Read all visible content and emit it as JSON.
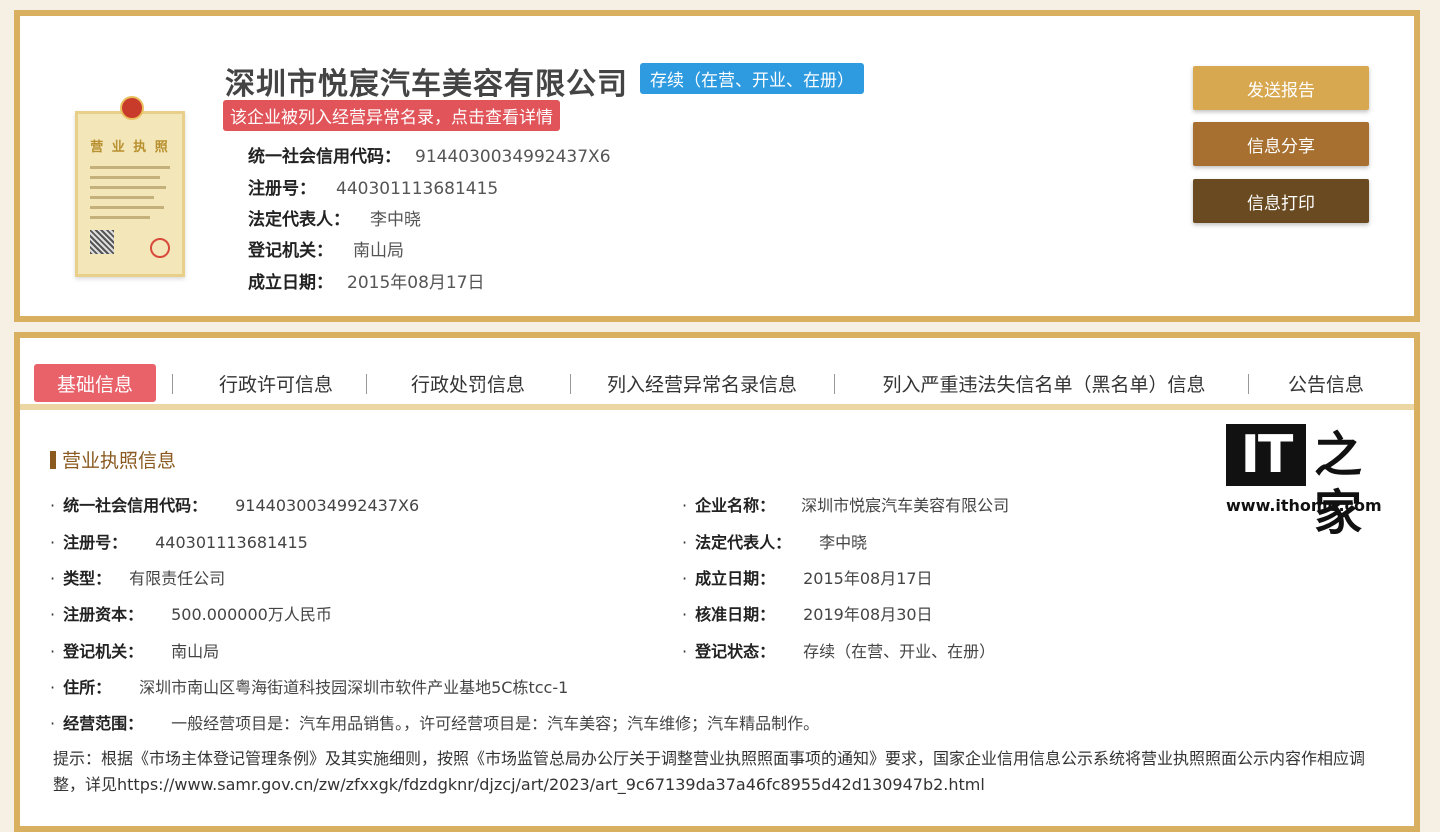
{
  "header": {
    "company_name": "深圳市悦宸汽车美容有限公司",
    "status": "存续（在营、开业、在册）",
    "abnormal_alert": "该企业被列入经营异常名录，点击查看详情",
    "license_title": "营 业 执 照",
    "summary": [
      {
        "key": "统一社会信用代码：",
        "value": "9144030034992437X6"
      },
      {
        "key": "注册号：",
        "value": "440301113681415"
      },
      {
        "key": "法定代表人：",
        "value": "李中晓"
      },
      {
        "key": "登记机关：",
        "value": "南山局"
      },
      {
        "key": "成立日期：",
        "value": "2015年08月17日"
      }
    ]
  },
  "actions": {
    "report": "发送报告",
    "share": "信息分享",
    "print": "信息打印"
  },
  "tabs": [
    "基础信息",
    "行政许可信息",
    "行政处罚信息",
    "列入经营异常名录信息",
    "列入严重违法失信名单（黑名单）信息",
    "公告信息"
  ],
  "section": {
    "title": "营业执照信息",
    "fields": {
      "credit_code": {
        "key": "统一社会信用代码：",
        "value": "9144030034992437X6"
      },
      "company_name": {
        "key": "企业名称：",
        "value": "深圳市悦宸汽车美容有限公司"
      },
      "reg_no": {
        "key": "注册号：",
        "value": "440301113681415"
      },
      "legal_rep": {
        "key": "法定代表人：",
        "value": "李中晓"
      },
      "type": {
        "key": "类型：",
        "value": "有限责任公司"
      },
      "established": {
        "key": "成立日期：",
        "value": "2015年08月17日"
      },
      "capital": {
        "key": "注册资本：",
        "value": "500.000000万人民币"
      },
      "approved": {
        "key": "核准日期：",
        "value": "2019年08月30日"
      },
      "authority": {
        "key": "登记机关：",
        "value": "南山局"
      },
      "reg_status": {
        "key": "登记状态：",
        "value": "存续（在营、开业、在册）"
      },
      "address": {
        "key": "住所：",
        "value": "深圳市南山区粤海街道科技园深圳市软件产业基地5C栋tcc-1"
      },
      "scope": {
        "key": "经营范围：",
        "value": "一般经营项目是：汽车用品销售。，许可经营项目是：汽车美容；汽车维修；汽车精品制作。"
      }
    },
    "notice": "提示：根据《市场主体登记管理条例》及其实施细则，按照《市场监管总局办公厅关于调整营业执照照面事项的通知》要求，国家企业信用信息公示系统将营业执照照面公示内容作相应调整，详见https://www.samr.gov.cn/zw/zfxxgk/fdzdgknr/djzcj/art/2023/art_9c67139da37a46fc8955d42d130947b2.html"
  },
  "watermark": {
    "logo_text": "IT",
    "logo_zh": "之家",
    "url": "www.ithome.com"
  }
}
